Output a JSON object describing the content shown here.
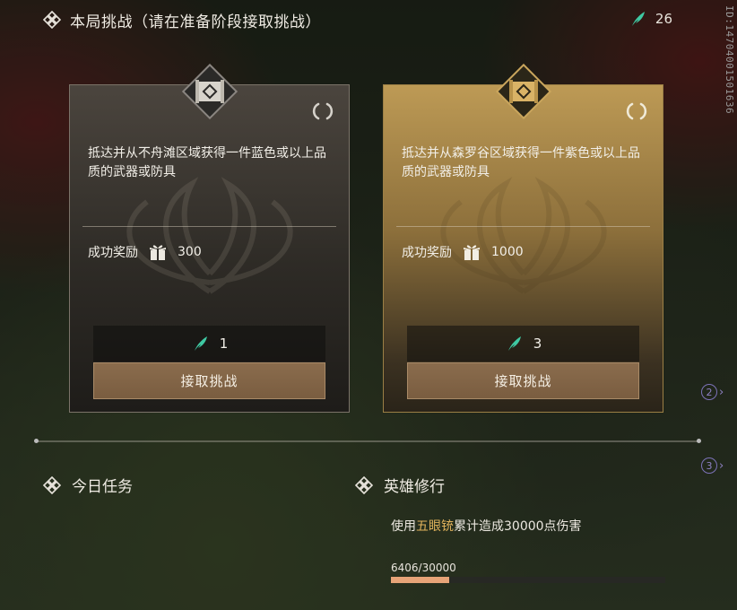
{
  "header": {
    "title": "本局挑战（请在准备阶段接取挑战）",
    "currency_value": "26"
  },
  "side_id": "ID:14704001501636",
  "cards": [
    {
      "description": "抵达并从不舟滩区域获得一件蓝色或以上品质的武器或防具",
      "reward_label": "成功奖励",
      "reward_value": "300",
      "cost_value": "1",
      "button_label": "接取挑战",
      "theme": "dark"
    },
    {
      "description": "抵达并从森罗谷区域获得一件紫色或以上品质的武器或防具",
      "reward_label": "成功奖励",
      "reward_value": "1000",
      "cost_value": "3",
      "button_label": "接取挑战",
      "theme": "gold"
    }
  ],
  "daily_tasks": {
    "title": "今日任务"
  },
  "hero_training": {
    "title": "英雄修行",
    "task_prefix": "使用",
    "task_highlight": "五眼铳",
    "task_suffix": "累计造成30000点伤害",
    "progress_text": "6406/30000",
    "progress_current": 6406,
    "progress_total": 30000
  },
  "side_badges": [
    "2",
    "3"
  ],
  "colors": {
    "currency_feather": "#3fc9a3",
    "highlight": "#e0b25c",
    "progress_fill": "#e7a478",
    "button": "#8a6c4d"
  }
}
